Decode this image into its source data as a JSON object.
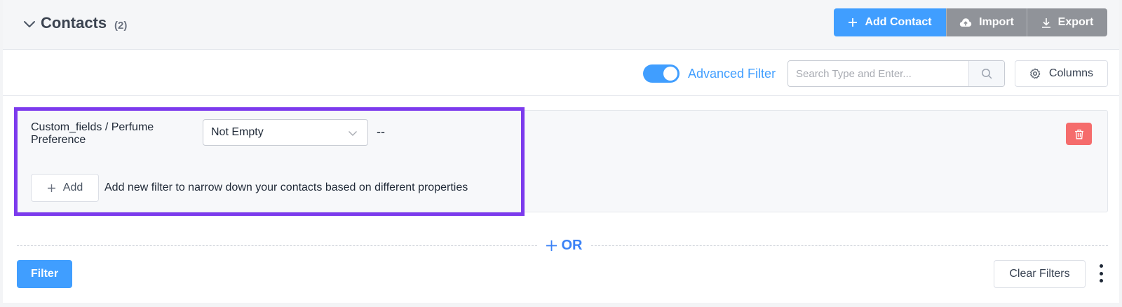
{
  "header": {
    "title": "Contacts",
    "count": "(2)",
    "add_contact_label": "Add Contact",
    "import_label": "Import",
    "export_label": "Export"
  },
  "toolbar": {
    "advanced_filter_label": "Advanced Filter",
    "advanced_filter_enabled": true,
    "search_placeholder": "Search Type and Enter...",
    "search_value": "",
    "columns_label": "Columns"
  },
  "filter_group": {
    "conditions": [
      {
        "field": "Custom_fields / Perfume Preference",
        "operator": "Not Empty",
        "value": "--"
      }
    ],
    "add_label": "Add",
    "add_hint": "Add new filter to narrow down your contacts based on different properties"
  },
  "or_label": "OR",
  "footer": {
    "filter_label": "Filter",
    "clear_filters_label": "Clear Filters"
  },
  "colors": {
    "primary": "#409eff",
    "secondary_button": "#909399",
    "danger": "#f56c6c",
    "highlight": "#7c3aed"
  }
}
